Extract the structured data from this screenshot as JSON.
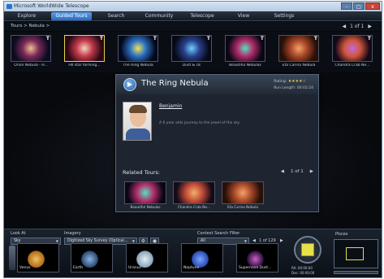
{
  "window": {
    "title": "Microsoft WorldWide Telescope",
    "controls": [
      "–",
      "□",
      "x"
    ]
  },
  "menu": [
    {
      "label": "Explore",
      "active": false
    },
    {
      "label": "Guided Tours",
      "active": true
    },
    {
      "label": "Search",
      "active": false
    },
    {
      "label": "Community",
      "active": false
    },
    {
      "label": "Telescope",
      "active": false
    },
    {
      "label": "View",
      "active": false
    },
    {
      "label": "Settings",
      "active": false
    }
  ],
  "breadcrumb": "Tours > Nebula >",
  "top_pager": {
    "prev": "◀",
    "text": "1 of 1",
    "next": "▶"
  },
  "tours": [
    {
      "label": "Orion Nebula - H...",
      "colors": [
        "#f2c08a",
        "#7a2a5a",
        "#0c0b20"
      ],
      "selected": false
    },
    {
      "label": "HII star forming...",
      "colors": [
        "#f6d4c0",
        "#c23a4a",
        "#2a0814"
      ],
      "selected": true
    },
    {
      "label": "The Ring Nebula",
      "colors": [
        "#f0e25a",
        "#2a6fc2",
        "#05081a"
      ],
      "selected": false
    },
    {
      "label": "Dust & Us",
      "colors": [
        "#6ad2ff",
        "#2a3f8a",
        "#060a18"
      ],
      "selected": false
    },
    {
      "label": "Beautiful Nebulas",
      "colors": [
        "#58e0c0",
        "#b02c6a",
        "#0a0616"
      ],
      "selected": false
    },
    {
      "label": "Eta Carina Nebula",
      "colors": [
        "#f3a46a",
        "#a84828",
        "#281008"
      ],
      "selected": false
    },
    {
      "label": "Chandra Crab Ne...",
      "colors": [
        "#c06adf",
        "#d2563a",
        "#120818"
      ],
      "selected": false
    }
  ],
  "tour_panel": {
    "play_symbol": "▶",
    "title": "The Ring Nebula",
    "rating_label": "Rating:",
    "stars": "★★★★☆",
    "run_length_label": "Run Length:",
    "run_length": "00:02:24",
    "author": "Benjamin",
    "description": "A 6 year olds journey to the jewel of the sky",
    "related_label": "Related Tours:",
    "related_pager": {
      "prev": "◀",
      "text": "1 of 1",
      "next": "▶"
    },
    "related": [
      {
        "label": "Beautiful Nebulas",
        "colors": [
          "#58e0c0",
          "#b02c6a",
          "#0a0616"
        ]
      },
      {
        "label": "Chandra Crab Ne...",
        "colors": [
          "#f0b06a",
          "#c04a38",
          "#140a18"
        ]
      },
      {
        "label": "Eta Carina Nebula",
        "colors": [
          "#f3a46a",
          "#a84828",
          "#281008"
        ]
      }
    ]
  },
  "bottom": {
    "look_at_label": "Look At",
    "look_at_value": "Sky",
    "imagery_label": "Imagery",
    "imagery_value": "Digitized Sky Survey (Optical...",
    "context_label": "Context Search Filter",
    "context_value": "All",
    "context_pager": {
      "prev": "◀",
      "text": "1 of 129",
      "next": "▶"
    },
    "planets": [
      {
        "label": "Venus",
        "colors": [
          "#f2c060",
          "#b06a1a"
        ]
      },
      {
        "label": "Earth",
        "colors": [
          "#8ab4e0",
          "#2a4a70"
        ]
      },
      {
        "label": "Uranus",
        "colors": [
          "#e6eef2",
          "#8aa4b8"
        ]
      },
      {
        "label": "Neptune",
        "colors": [
          "#7aa6ff",
          "#2a4ab0"
        ]
      },
      {
        "label": "Supernova Dust...",
        "colors": [
          "#d060c0",
          "#2a1040"
        ]
      }
    ],
    "ra_label": "RA:",
    "ra_value": "00:00:00",
    "dec_label": "Dec:",
    "dec_value": "00:00:00",
    "minimap_label": "Pisces"
  },
  "accent": "#2a6ac0"
}
